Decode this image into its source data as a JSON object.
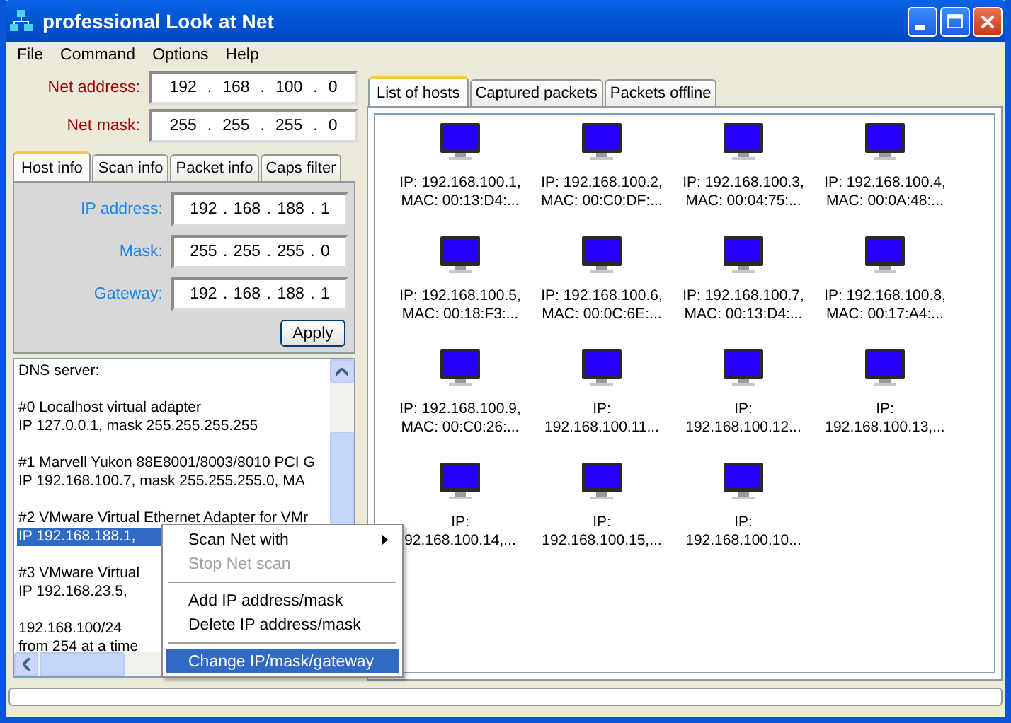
{
  "window": {
    "title": "professional Look at Net"
  },
  "menu": [
    "File",
    "Command",
    "Options",
    "Help"
  ],
  "octet_separator": ".",
  "net_fields": [
    {
      "label": "Net address:",
      "octets": [
        "192",
        "168",
        "100",
        "0"
      ]
    },
    {
      "label": "Net mask:",
      "octets": [
        "255",
        "255",
        "255",
        "0"
      ]
    }
  ],
  "left_tabs": [
    {
      "label": "Host info",
      "selected": true
    },
    {
      "label": "Scan info",
      "selected": false
    },
    {
      "label": "Packet info",
      "selected": false
    },
    {
      "label": "Caps filter",
      "selected": false
    }
  ],
  "host_fields": [
    {
      "label": "IP address:",
      "octets": [
        "192",
        "168",
        "188",
        "1"
      ]
    },
    {
      "label": "Mask:",
      "octets": [
        "255",
        "255",
        "255",
        "0"
      ]
    },
    {
      "label": "Gateway:",
      "octets": [
        "192",
        "168",
        "188",
        "1"
      ]
    }
  ],
  "apply_button": "Apply",
  "info_list": [
    {
      "lines": [
        {
          "text": "DNS server:",
          "selected": false
        }
      ]
    },
    {
      "lines": [
        {
          "text": "#0 Localhost virtual adapter",
          "selected": false
        },
        {
          "text": "IP  127.0.0.1, mask 255.255.255.255",
          "selected": false
        }
      ]
    },
    {
      "lines": [
        {
          "text": "#1 Marvell Yukon 88E8001/8003/8010 PCI G",
          "selected": false
        },
        {
          "text": "IP 192.168.100.7, mask 255.255.255.0, MA",
          "selected": false
        }
      ]
    },
    {
      "lines": [
        {
          "text": "#2 VMware Virtual Ethernet Adapter for VMr",
          "selected": false
        },
        {
          "text": "IP 192.168.188.1,",
          "selected": true
        }
      ]
    },
    {
      "lines": [
        {
          "text": "#3 VMware Virtual",
          "selected": false
        },
        {
          "text": "IP 192.168.23.5,",
          "selected": false
        }
      ]
    },
    {
      "lines": [
        {
          "text": "192.168.100/24",
          "selected": false
        },
        {
          "text": "from 254 at a time",
          "selected": false
        }
      ]
    }
  ],
  "context_menu": [
    {
      "kind": "item",
      "label": "Scan Net with",
      "submenu": true,
      "disabled": false,
      "selected": false
    },
    {
      "kind": "item",
      "label": "Stop Net scan",
      "submenu": false,
      "disabled": true,
      "selected": false
    },
    {
      "kind": "separator"
    },
    {
      "kind": "item",
      "label": "Add IP address/mask",
      "submenu": false,
      "disabled": false,
      "selected": false
    },
    {
      "kind": "item",
      "label": "Delete IP address/mask",
      "submenu": false,
      "disabled": false,
      "selected": false
    },
    {
      "kind": "separator"
    },
    {
      "kind": "item",
      "label": "Change IP/mask/gateway",
      "submenu": false,
      "disabled": false,
      "selected": true
    }
  ],
  "right_tabs": [
    {
      "label": "List of hosts",
      "selected": true
    },
    {
      "label": "Captured packets",
      "selected": false
    },
    {
      "label": "Packets offline",
      "selected": false
    }
  ],
  "hosts": [
    {
      "lines": [
        "IP: 192.168.100.1,",
        "MAC: 00:13:D4:..."
      ]
    },
    {
      "lines": [
        "IP: 192.168.100.2,",
        "MAC: 00:C0:DF:..."
      ]
    },
    {
      "lines": [
        "IP: 192.168.100.3,",
        "MAC: 00:04:75:..."
      ]
    },
    {
      "lines": [
        "IP: 192.168.100.4,",
        "MAC: 00:0A:48:..."
      ]
    },
    {
      "lines": [
        "IP: 192.168.100.5,",
        "MAC: 00:18:F3:..."
      ]
    },
    {
      "lines": [
        "IP: 192.168.100.6,",
        "MAC: 00:0C:6E:..."
      ]
    },
    {
      "lines": [
        "IP: 192.168.100.7,",
        "MAC: 00:13:D4:..."
      ]
    },
    {
      "lines": [
        "IP: 192.168.100.8,",
        "MAC: 00:17:A4:..."
      ]
    },
    {
      "lines": [
        "IP: 192.168.100.9,",
        "MAC: 00:C0:26:..."
      ]
    },
    {
      "lines": [
        "IP:",
        "192.168.100.11..."
      ]
    },
    {
      "lines": [
        "IP:",
        "192.168.100.12..."
      ]
    },
    {
      "lines": [
        "IP:",
        "192.168.100.13,..."
      ]
    },
    {
      "lines": [
        "IP:",
        "92.168.100.14,..."
      ]
    },
    {
      "lines": [
        "IP:",
        "192.168.100.15,..."
      ]
    },
    {
      "lines": [
        "IP:",
        "192.168.100.10..."
      ]
    }
  ],
  "status_bar": {
    "progress": {
      "level": 0
    }
  }
}
